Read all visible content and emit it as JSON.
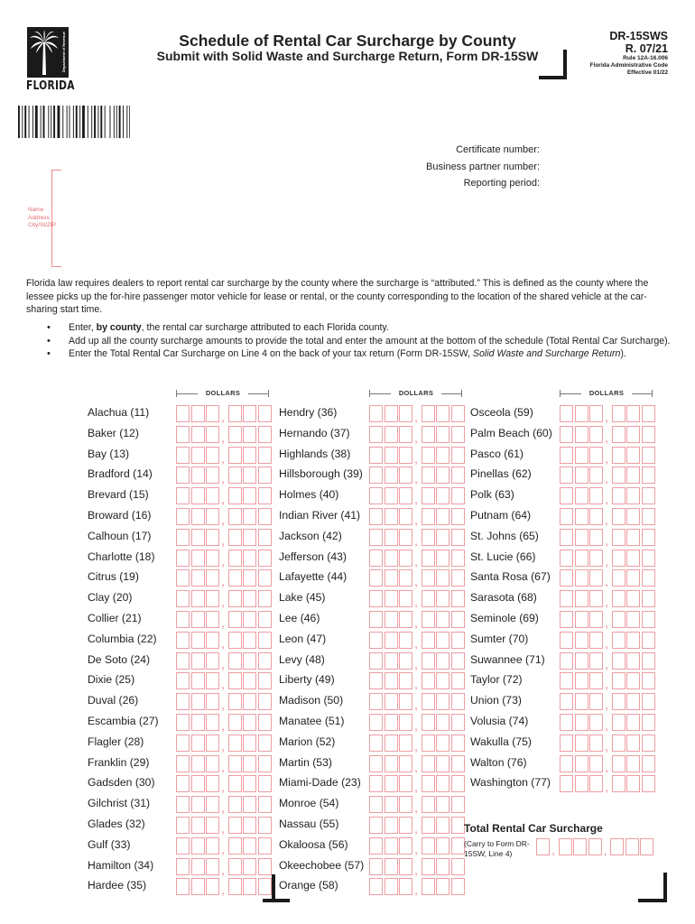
{
  "header": {
    "logo": {
      "icon": "palm-tree-icon",
      "wordmark": "FLORIDA",
      "vertical_text": "Department of Revenue"
    },
    "title": "Schedule of Rental Car Surcharge by County",
    "subtitle": "Submit with Solid Waste and Surcharge Return, Form DR-15SW",
    "form_id": "DR-15SWS",
    "revision": "R. 07/21",
    "rule": "Rule 12A-16.006",
    "code": "Florida Administrative Code",
    "effective": "Effective 01/22"
  },
  "meta_fields": [
    {
      "label": "Certificate number:"
    },
    {
      "label": "Business partner number:"
    },
    {
      "label": "Reporting period:"
    }
  ],
  "address_block": {
    "labels": [
      "Name",
      "Address",
      "City/St/ZIP"
    ]
  },
  "intro": "Florida law requires dealers to report rental car surcharge by the county where the surcharge is “attributed.” This is defined as the county where the lessee picks up the for-hire passenger motor vehicle for lease or rental, or the county corresponding to the location of the shared vehicle at the car-sharing start time.",
  "instructions": [
    {
      "pre": "Enter, ",
      "bold": "by county",
      "post": ", the rental car surcharge attributed to each Florida county.",
      "italic": ""
    },
    {
      "pre": "Add up all the county surcharge amounts to provide the total and enter the amount at the bottom of the schedule (Total Rental Car Surcharge).",
      "bold": "",
      "post": "",
      "italic": ""
    },
    {
      "pre": "Enter the Total Rental Car Surcharge on Line 4 on the back of your tax return (Form DR-15SW, ",
      "bold": "",
      "italic": "Solid Waste and Surcharge Return",
      "post": ")."
    }
  ],
  "dollars_header": "DOLLARS",
  "colors": {
    "box_border": "#ec9ea2",
    "address_red": "#e06b72",
    "ink": "#1a1a1a"
  },
  "columns": [
    {
      "counties": [
        {
          "name": "Alachua (11)",
          "value": ""
        },
        {
          "name": "Baker (12)",
          "value": ""
        },
        {
          "name": "Bay (13)",
          "value": ""
        },
        {
          "name": "Bradford (14)",
          "value": ""
        },
        {
          "name": "Brevard (15)",
          "value": ""
        },
        {
          "name": "Broward (16)",
          "value": ""
        },
        {
          "name": "Calhoun (17)",
          "value": ""
        },
        {
          "name": "Charlotte (18)",
          "value": ""
        },
        {
          "name": "Citrus (19)",
          "value": ""
        },
        {
          "name": "Clay (20)",
          "value": ""
        },
        {
          "name": "Collier (21)",
          "value": ""
        },
        {
          "name": "Columbia (22)",
          "value": ""
        },
        {
          "name": "De Soto (24)",
          "value": ""
        },
        {
          "name": "Dixie (25)",
          "value": ""
        },
        {
          "name": "Duval (26)",
          "value": ""
        },
        {
          "name": "Escambia (27)",
          "value": ""
        },
        {
          "name": "Flagler (28)",
          "value": ""
        },
        {
          "name": "Franklin (29)",
          "value": ""
        },
        {
          "name": "Gadsden (30)",
          "value": ""
        },
        {
          "name": "Gilchrist (31)",
          "value": ""
        },
        {
          "name": "Glades (32)",
          "value": ""
        },
        {
          "name": "Gulf (33)",
          "value": ""
        },
        {
          "name": "Hamilton (34)",
          "value": ""
        },
        {
          "name": "Hardee (35)",
          "value": ""
        }
      ]
    },
    {
      "counties": [
        {
          "name": "Hendry (36)",
          "value": ""
        },
        {
          "name": "Hernando (37)",
          "value": ""
        },
        {
          "name": "Highlands (38)",
          "value": ""
        },
        {
          "name": "Hillsborough (39)",
          "value": ""
        },
        {
          "name": "Holmes (40)",
          "value": ""
        },
        {
          "name": "Indian River (41)",
          "value": ""
        },
        {
          "name": "Jackson (42)",
          "value": ""
        },
        {
          "name": "Jefferson (43)",
          "value": ""
        },
        {
          "name": "Lafayette (44)",
          "value": ""
        },
        {
          "name": "Lake (45)",
          "value": ""
        },
        {
          "name": "Lee (46)",
          "value": ""
        },
        {
          "name": "Leon (47)",
          "value": ""
        },
        {
          "name": "Levy (48)",
          "value": ""
        },
        {
          "name": "Liberty (49)",
          "value": ""
        },
        {
          "name": "Madison (50)",
          "value": ""
        },
        {
          "name": "Manatee (51)",
          "value": ""
        },
        {
          "name": "Marion (52)",
          "value": ""
        },
        {
          "name": "Martin (53)",
          "value": ""
        },
        {
          "name": "Miami-Dade (23)",
          "value": ""
        },
        {
          "name": "Monroe (54)",
          "value": ""
        },
        {
          "name": "Nassau (55)",
          "value": ""
        },
        {
          "name": "Okaloosa (56)",
          "value": ""
        },
        {
          "name": "Okeechobee (57)",
          "value": ""
        },
        {
          "name": "Orange (58)",
          "value": ""
        }
      ]
    },
    {
      "counties": [
        {
          "name": "Osceola (59)",
          "value": ""
        },
        {
          "name": "Palm Beach (60)",
          "value": ""
        },
        {
          "name": "Pasco (61)",
          "value": ""
        },
        {
          "name": "Pinellas (62)",
          "value": ""
        },
        {
          "name": "Polk (63)",
          "value": ""
        },
        {
          "name": "Putnam (64)",
          "value": ""
        },
        {
          "name": "St. Johns (65)",
          "value": ""
        },
        {
          "name": "St. Lucie (66)",
          "value": ""
        },
        {
          "name": "Santa Rosa (67)",
          "value": ""
        },
        {
          "name": "Sarasota (68)",
          "value": ""
        },
        {
          "name": "Seminole (69)",
          "value": ""
        },
        {
          "name": "Sumter (70)",
          "value": ""
        },
        {
          "name": "Suwannee (71)",
          "value": ""
        },
        {
          "name": "Taylor (72)",
          "value": ""
        },
        {
          "name": "Union (73)",
          "value": ""
        },
        {
          "name": "Volusia (74)",
          "value": ""
        },
        {
          "name": "Wakulla (75)",
          "value": ""
        },
        {
          "name": "Walton (76)",
          "value": ""
        },
        {
          "name": "Washington (77)",
          "value": ""
        }
      ]
    }
  ],
  "total": {
    "label": "Total Rental Car Surcharge",
    "note": "(Carry to Form DR-15SW, Line 4)",
    "value": ""
  }
}
